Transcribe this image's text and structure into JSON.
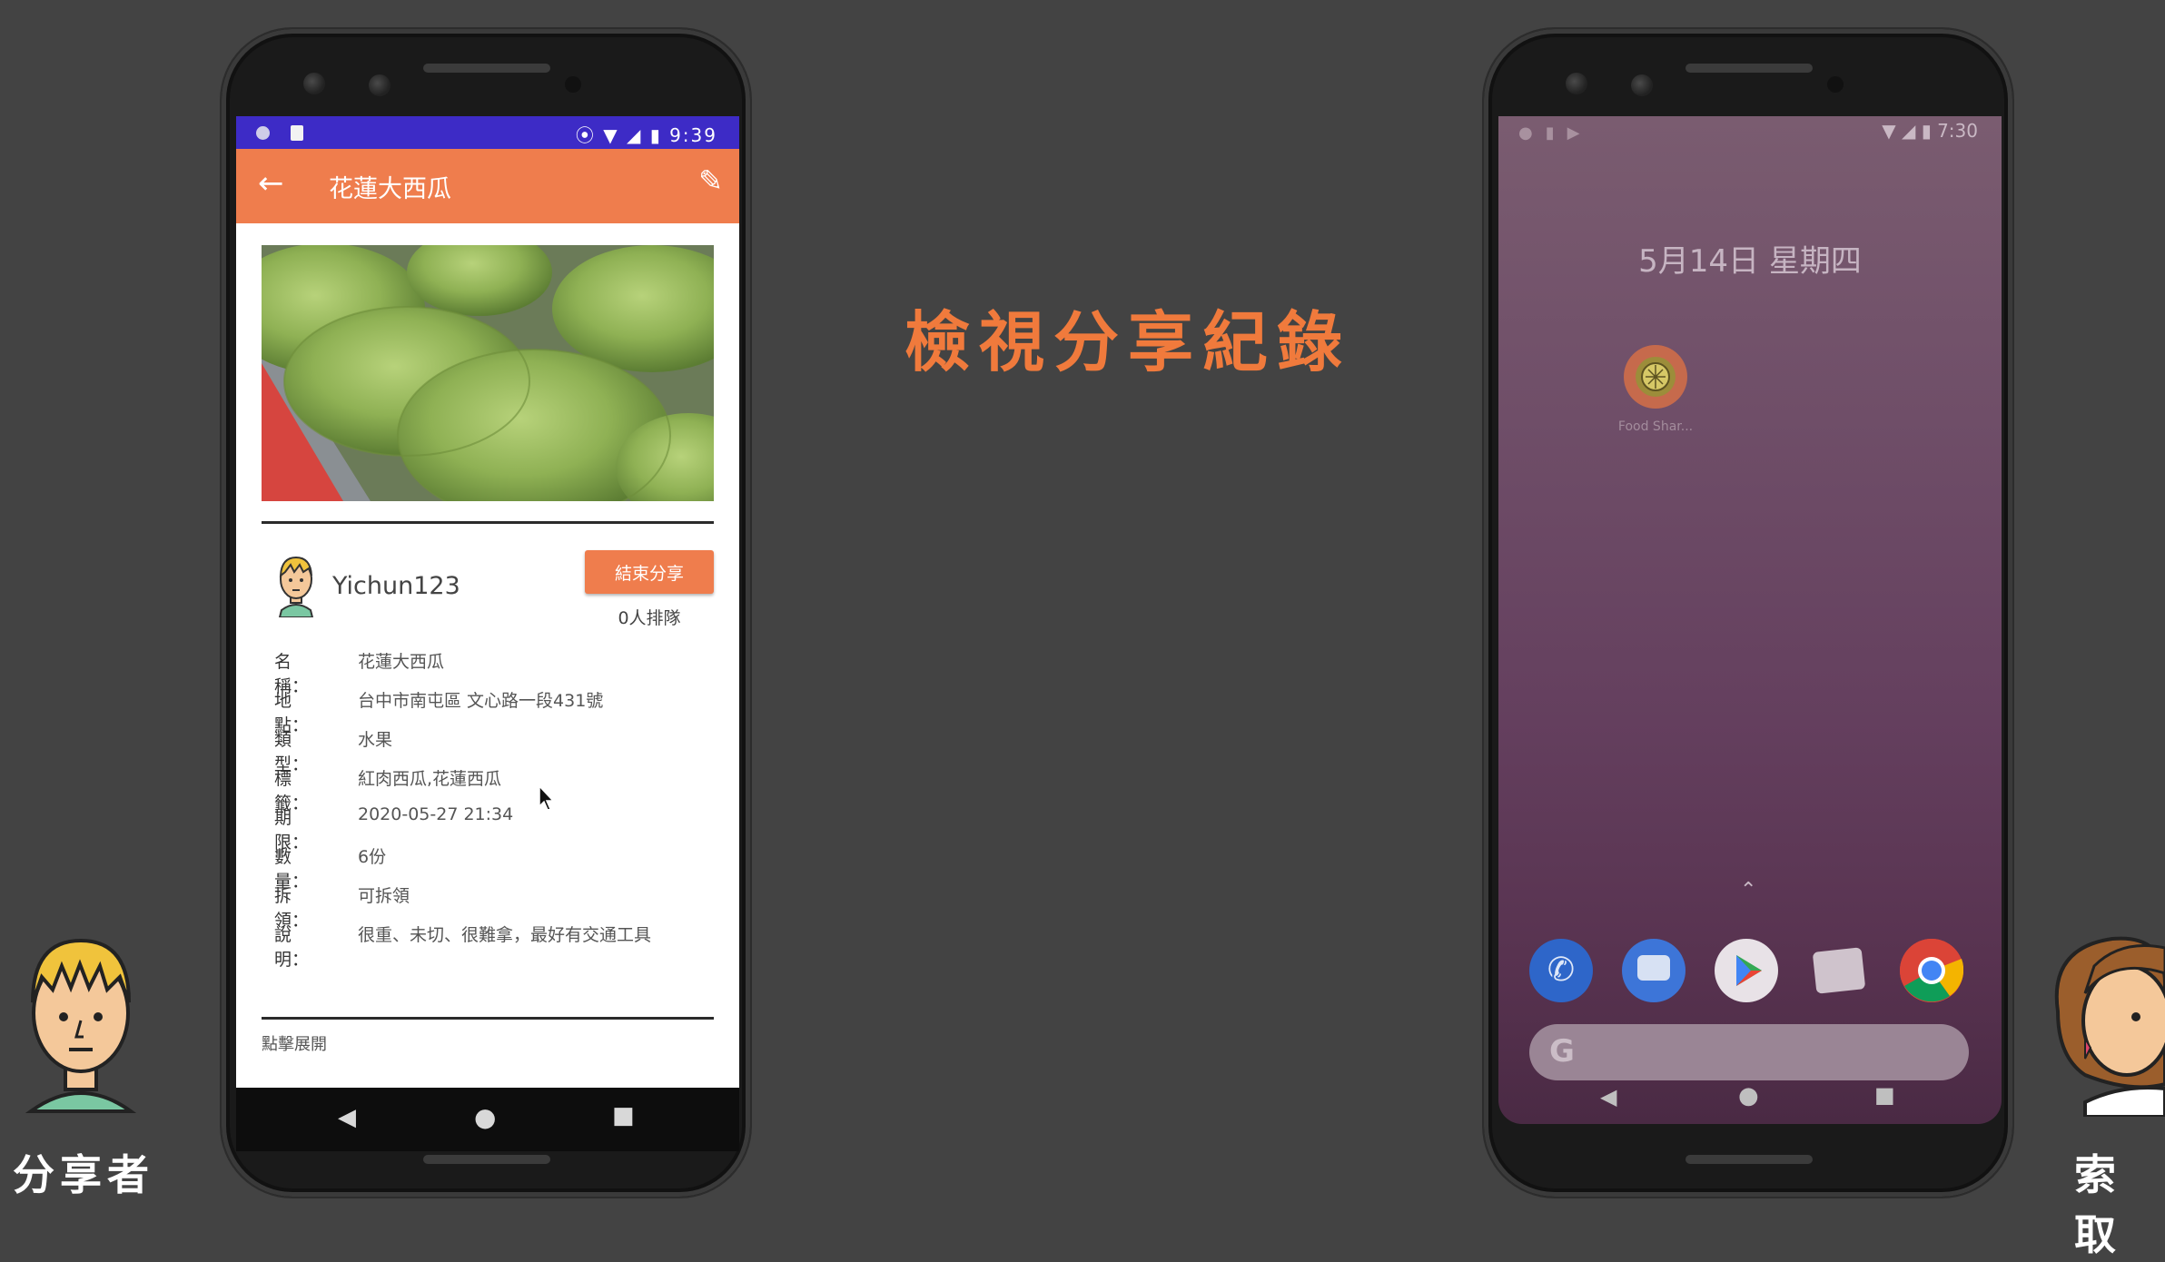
{
  "heading": "檢視分享紀錄",
  "left_caption": "分享者",
  "right_caption": "索取",
  "left_phone": {
    "status_time": "9:39",
    "appbar_title": "花蓮大西瓜",
    "username": "Yichun123",
    "end_share_button": "結束分享",
    "queue_text": "0人排隊",
    "fields": [
      {
        "label": "名稱：",
        "value": "花蓮大西瓜"
      },
      {
        "label": "地點：",
        "value": "台中市南屯區 文心路一段431號"
      },
      {
        "label": "類型：",
        "value": "水果"
      },
      {
        "label": "標籤：",
        "value": "紅肉西瓜,花蓮西瓜"
      },
      {
        "label": "期限：",
        "value": "2020-05-27 21:34"
      },
      {
        "label": "數量：",
        "value": "6份"
      },
      {
        "label": "拆領：",
        "value": "可拆領"
      },
      {
        "label": "說明：",
        "value": "很重、未切、很難拿，最好有交通工具"
      }
    ],
    "expand_text": "點擊展開"
  },
  "right_phone": {
    "status_time": "7:30",
    "date_text": "5月14日 星期四",
    "app_label": "Food Shar..."
  },
  "colors": {
    "accent": "#ef7d4d",
    "status_bar": "#3d2bc6",
    "heading": "#f07a3c",
    "background": "#434343"
  }
}
